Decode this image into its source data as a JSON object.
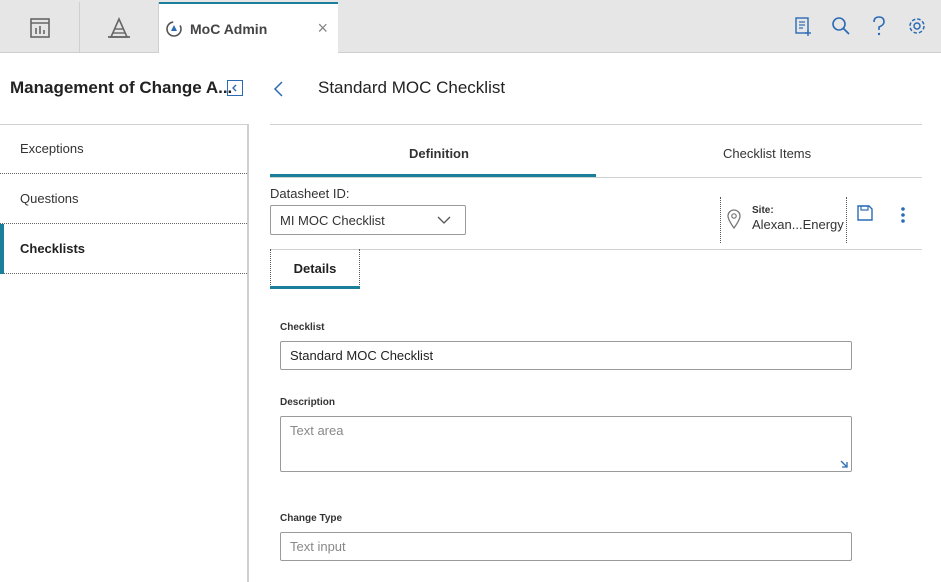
{
  "topbar": {
    "active_tab": {
      "label": "MoC Admin",
      "close": "×"
    }
  },
  "left": {
    "title": "Management of Change A...",
    "nav": [
      "Exceptions",
      "Questions",
      "Checklists"
    ]
  },
  "main": {
    "title": "Standard MOC Checklist",
    "tabs": {
      "definition": "Definition",
      "checklist_items": "Checklist Items"
    },
    "datasheet": {
      "label": "Datasheet ID:",
      "value": "MI MOC Checklist"
    },
    "site": {
      "label": "Site:",
      "value": "Alexan...Energy"
    },
    "details_tab": "Details",
    "fields": {
      "checklist": {
        "label": "Checklist",
        "value": "Standard MOC Checklist"
      },
      "description": {
        "label": "Description",
        "placeholder": "Text area"
      },
      "change_type": {
        "label": "Change Type",
        "placeholder": "Text input"
      }
    }
  },
  "colors": {
    "accent": "#1a7f9b",
    "link": "#2b6bb5"
  }
}
